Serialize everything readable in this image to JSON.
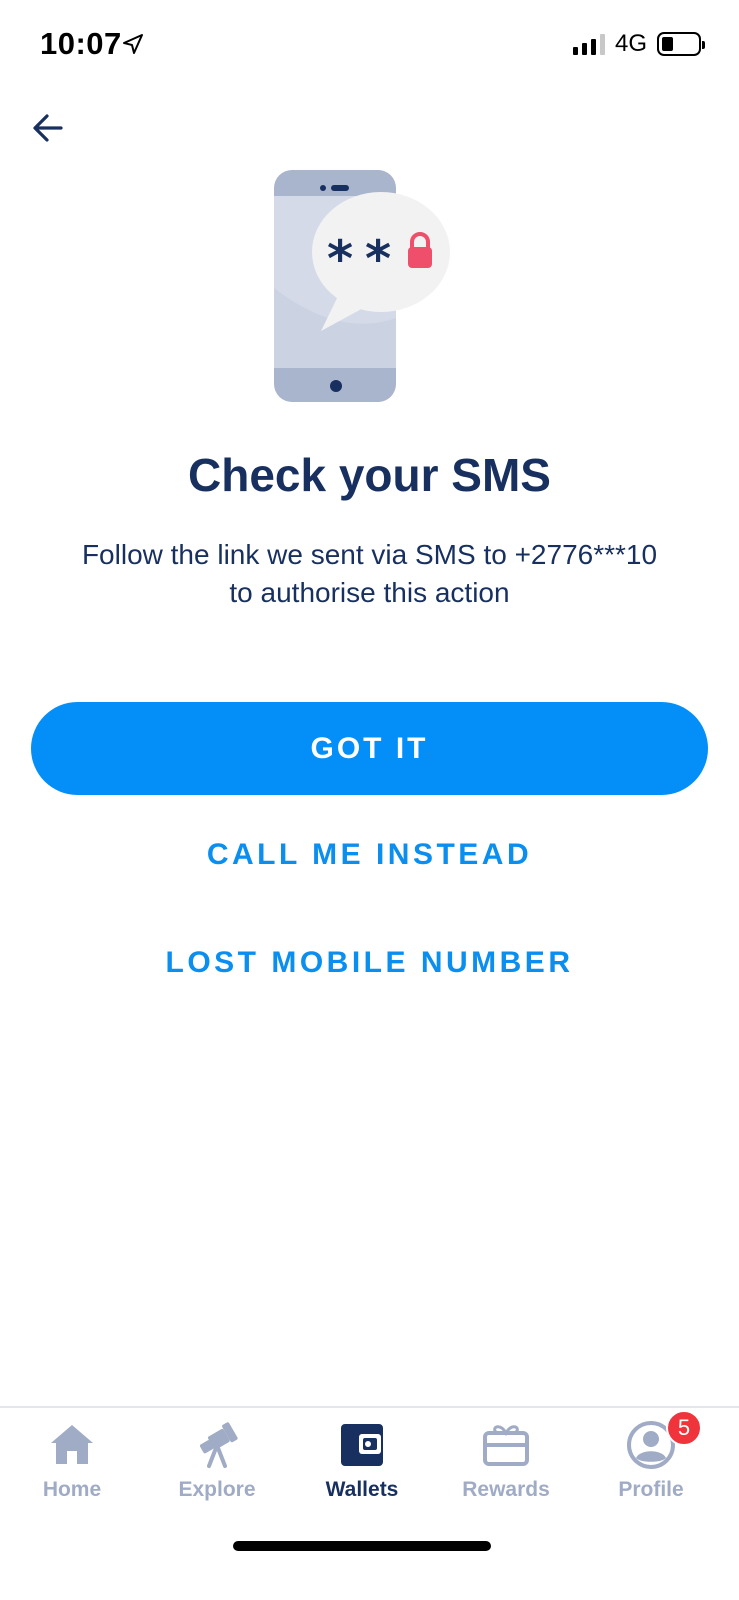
{
  "status_bar": {
    "time": "10:07",
    "network": "4G"
  },
  "header": {
    "back_icon": "arrow-left-icon"
  },
  "illustration": {
    "description_icon": "phone-sms-lock-icon",
    "bubble_text": "**",
    "colors": {
      "phone": "#a9b4cd",
      "screen": "#d4dae7",
      "bubble": "#f2f2f3",
      "lock": "#ef4f6b"
    }
  },
  "content": {
    "title": "Check your SMS",
    "subtitle_line1": "Follow the link we sent via SMS to +2776***10",
    "subtitle_line2": "to authorise this action"
  },
  "actions": {
    "primary_label": "GOT IT",
    "call_label": "CALL ME INSTEAD",
    "lost_label": "LOST MOBILE NUMBER"
  },
  "tab_bar": {
    "tabs": [
      {
        "label": "Home",
        "icon": "home-icon",
        "active": false
      },
      {
        "label": "Explore",
        "icon": "telescope-icon",
        "active": false
      },
      {
        "label": "Wallets",
        "icon": "wallet-icon",
        "active": true
      },
      {
        "label": "Rewards",
        "icon": "gift-card-icon",
        "active": false
      },
      {
        "label": "Profile",
        "icon": "user-icon",
        "active": false,
        "badge": "5"
      }
    ]
  },
  "theme": {
    "accent": "#038ef8",
    "text_dark": "#17305f",
    "tab_inactive": "#a0abc6",
    "badge": "#f0343c"
  }
}
